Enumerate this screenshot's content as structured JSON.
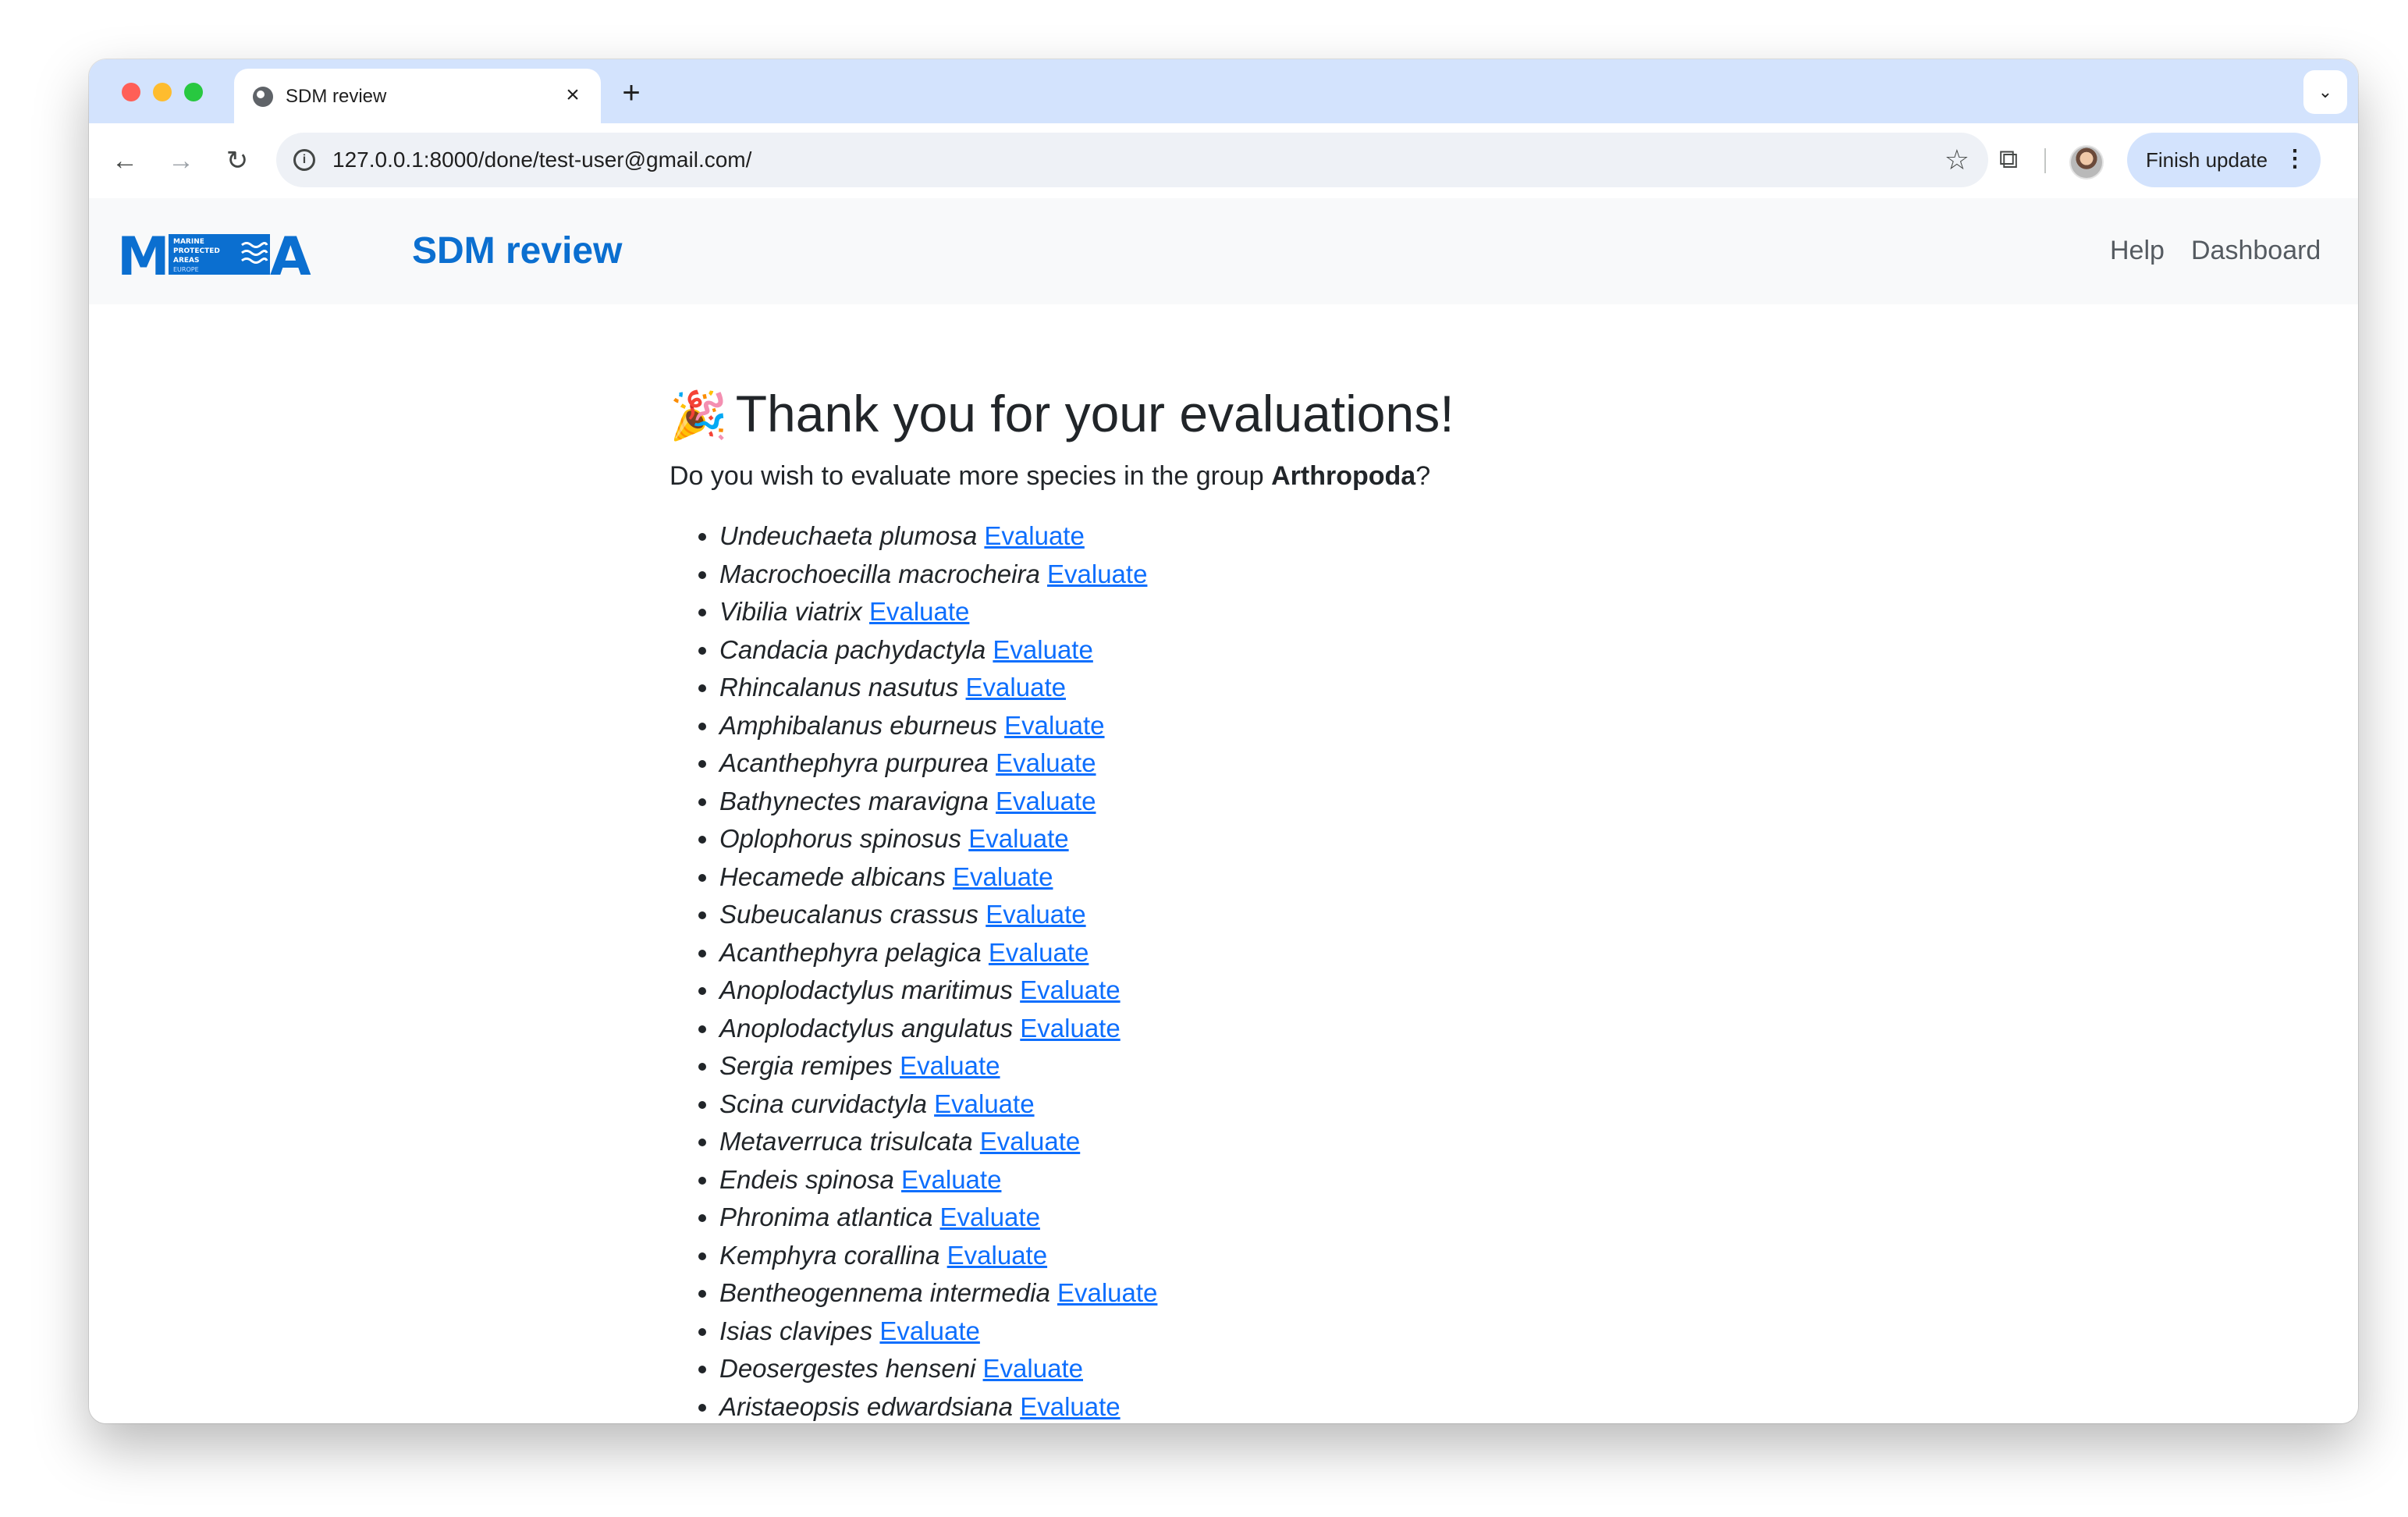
{
  "browser": {
    "tab": {
      "title": "SDM review",
      "close": "×"
    },
    "new_tab": "+",
    "tab_search": "⌄",
    "nav": {
      "back": "←",
      "forward": "→",
      "reload": "↻"
    },
    "info": "i",
    "url": "127.0.0.1:8000/done/test-user@gmail.com/",
    "star": "☆",
    "extensions": "⧉",
    "finish_update": {
      "label": "Finish update",
      "menu": "⋮"
    }
  },
  "header": {
    "logo_text": "MPA",
    "logo_sub": [
      "MARINE",
      "PROTECTED",
      "AREAS",
      "EUROPE"
    ],
    "title": "SDM review",
    "nav": {
      "help": "Help",
      "dashboard": "Dashboard"
    }
  },
  "main": {
    "heading_emoji": "🎉",
    "heading": "Thank you for your evaluations!",
    "question_prefix": "Do you wish to evaluate more species in the group ",
    "group": "Arthropoda",
    "question_suffix": "?",
    "link_label": "Evaluate",
    "species": [
      "Undeuchaeta plumosa",
      "Macrochoecilla macrocheira",
      "Vibilia viatrix",
      "Candacia pachydactyla",
      "Rhincalanus nasutus",
      "Amphibalanus eburneus",
      "Acanthephyra purpurea",
      "Bathynectes maravigna",
      "Oplophorus spinosus",
      "Hecamede albicans",
      "Subeucalanus crassus",
      "Acanthephyra pelagica",
      "Anoplodactylus maritimus",
      "Anoplodactylus angulatus",
      "Sergia remipes",
      "Scina curvidactyla",
      "Metaverruca trisulcata",
      "Endeis spinosa",
      "Phronima atlantica",
      "Kemphyra corallina",
      "Bentheogennema intermedia",
      "Isias clavipes",
      "Deosergestes henseni",
      "Aristaeopsis edwardsiana"
    ]
  },
  "colors": {
    "brand": "#0b6fd0",
    "link": "#0d6efd",
    "tabstrip": "#d3e3fd",
    "header_bg": "#f8f9fa"
  }
}
